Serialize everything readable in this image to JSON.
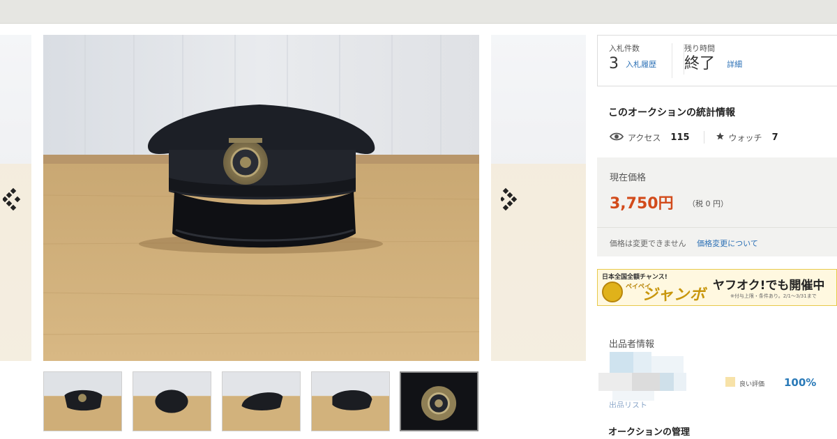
{
  "bid_box": {
    "bids_label": "入札件数",
    "bids_count": "3",
    "bids_link": "入札履歴",
    "time_label": "残り時間",
    "time_value": "終了",
    "time_link": "詳細"
  },
  "stats": {
    "title": "このオークションの統計情報",
    "access_label": "アクセス",
    "access_count": "115",
    "watch_label": "ウォッチ",
    "watch_count": "7"
  },
  "price": {
    "label": "現在価格",
    "value": "3,750円",
    "tax": "（税 0 円）",
    "note": "価格は変更できません",
    "link": "価格変更について",
    "accent_color": "#d24b1b"
  },
  "banner": {
    "line1": "日本全国全額チャンス!",
    "paypay": "ペイペイ",
    "jumbo": "ジャンボ",
    "right": "ヤフオク!でも開催中",
    "fine": "※付与上限・条件あり。2/1～3/31まで"
  },
  "seller": {
    "label": "出品者情報",
    "rating_label": "良い評価",
    "rating_value": "100%",
    "list_link": "出品リスト"
  },
  "management": {
    "title": "オークションの管理"
  },
  "gallery": {
    "thumbnail_count": 5,
    "active_thumbnail": 5,
    "icons": [
      "chevron-left-icon",
      "chevron-right-icon",
      "eye-icon",
      "star-icon"
    ]
  },
  "colors": {
    "link": "#2a6fb5",
    "rating": "#2a7ab8",
    "price": "#d24b1b"
  }
}
